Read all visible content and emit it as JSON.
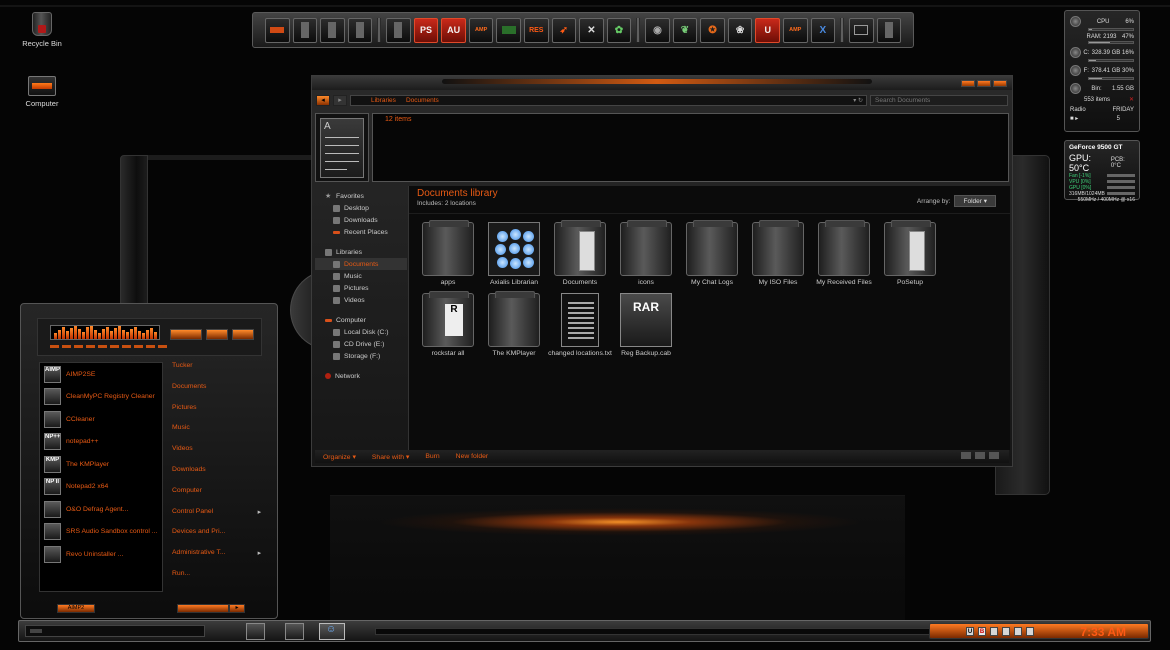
{
  "desktop": {
    "icons": [
      {
        "label": "Recycle Bin",
        "icon": "recycle-bin-icon"
      },
      {
        "label": "Computer",
        "icon": "computer-icon"
      }
    ]
  },
  "dock": {
    "labels": {
      "ps": "PS",
      "au": "AU",
      "amp": "AMP",
      "res": "RES",
      "u": "U",
      "amp2": "AMP",
      "x": "X"
    },
    "icons": [
      "window-icon",
      "tower-icon",
      "tower-icon",
      "tower-icon",
      "tower-icon",
      "photoshop-icon",
      "audition-icon",
      "amp-icon",
      "switch-icon",
      "res-icon",
      "arrow-icon",
      "tools-icon",
      "plant-icon",
      "disc-icon",
      "leaf-icon",
      "fox-icon",
      "flower-icon",
      "u-icon",
      "amp-icon",
      "x-icon",
      "monitor-icon",
      "tower-icon"
    ]
  },
  "gadget_cpu": {
    "cpu_label": "CPU",
    "cpu_value": "6%",
    "cpu_fill": 0.06,
    "ram_label": "RAM: 2193",
    "ram_value": "47%",
    "ram_fill": 0.47,
    "c_label": "C:",
    "c_value": "328.39 GB 16%",
    "c_fill": 0.16,
    "f_label": "F:",
    "f_value": "378.41 GB 30%",
    "f_fill": 0.3,
    "bin_label": "Bin:",
    "bin_size": "1.55 GB",
    "bin_items": "553 items",
    "radio_label": "Radio",
    "day": "FRIDAY",
    "date": "5"
  },
  "gadget_gpu": {
    "name": "GeForce 9500 GT",
    "temp": "GPU: 50°C",
    "pcb": "PCB: 0°C",
    "fan": "Fan [-1%]",
    "vpu": "VPU [0%]",
    "gpu": "GPU [0%]",
    "mem": "316MB/1024MB",
    "clock": "550MHz / 400MHz @ x16"
  },
  "explorer": {
    "breadcrumb": [
      "Libraries",
      "Documents"
    ],
    "search_placeholder": "Search Documents",
    "details_count": "12 items",
    "nav": {
      "favorites": "Favorites",
      "fav_items": [
        "Desktop",
        "Downloads",
        "Recent Places"
      ],
      "libraries": "Libraries",
      "lib_items": [
        "Documents",
        "Music",
        "Pictures",
        "Videos"
      ],
      "computer": "Computer",
      "comp_items": [
        "Local Disk (C:)",
        "CD Drive (E:)",
        "Storage (F:)"
      ],
      "network": "Network"
    },
    "library_title": "Documents library",
    "library_sub": "Includes:  2 locations",
    "arrange_label": "Arrange by:",
    "arrange_value": "Folder",
    "files": [
      {
        "name": "apps",
        "type": "folder"
      },
      {
        "name": "Axialis Librarian",
        "type": "axialis"
      },
      {
        "name": "Documents",
        "type": "folder-doc"
      },
      {
        "name": "icons",
        "type": "folder"
      },
      {
        "name": "My Chat Logs",
        "type": "folder"
      },
      {
        "name": "My ISO Files",
        "type": "folder"
      },
      {
        "name": "My Received Files",
        "type": "folder"
      },
      {
        "name": "PoSetup",
        "type": "folder-doc"
      },
      {
        "name": "rockstar all",
        "type": "folder-rock"
      },
      {
        "name": "The KMPlayer",
        "type": "folder"
      },
      {
        "name": "changed locations.txt",
        "type": "text"
      },
      {
        "name": "Reg Backup.cab",
        "type": "rar"
      }
    ],
    "rar_label": "RAR",
    "toolbar": {
      "organize": "Organize ▾",
      "share": "Share with ▾",
      "burn": "Burn",
      "new_folder": "New folder"
    }
  },
  "start_menu": {
    "programs": [
      {
        "name": "AIMP2SE",
        "pic": "AIMP"
      },
      {
        "name": "CleanMyPC Registry Cleaner",
        "pic": ""
      },
      {
        "name": "CCleaner",
        "pic": ""
      },
      {
        "name": "notepad++",
        "pic": "NP++"
      },
      {
        "name": "The KMPlayer",
        "pic": "KMP"
      },
      {
        "name": "Notepad2 x64",
        "pic": "NP II"
      },
      {
        "name": "O&O Defrag Agent...",
        "pic": ""
      },
      {
        "name": "SRS Audio Sandbox control ...",
        "pic": ""
      },
      {
        "name": "Revo Uninstaller ...",
        "pic": ""
      }
    ],
    "links": [
      {
        "name": "Tucker",
        "arrow": ""
      },
      {
        "name": "Documents",
        "arrow": ""
      },
      {
        "name": "Pictures",
        "arrow": ""
      },
      {
        "name": "Music",
        "arrow": ""
      },
      {
        "name": "Videos",
        "arrow": ""
      },
      {
        "name": "Downloads",
        "arrow": ""
      },
      {
        "name": "Computer",
        "arrow": ""
      },
      {
        "name": "Control Panel",
        "arrow": "▸"
      },
      {
        "name": "Devices and Pri...",
        "arrow": ""
      },
      {
        "name": "Administrative T...",
        "arrow": "▸"
      },
      {
        "name": "Run...",
        "arrow": ""
      }
    ],
    "footer_left": "AIMP2"
  },
  "taskbar": {
    "clock": "7:33 AM",
    "tray": [
      "U",
      "B"
    ]
  },
  "colors": {
    "accent": "#e85a14",
    "background": "#050505"
  }
}
